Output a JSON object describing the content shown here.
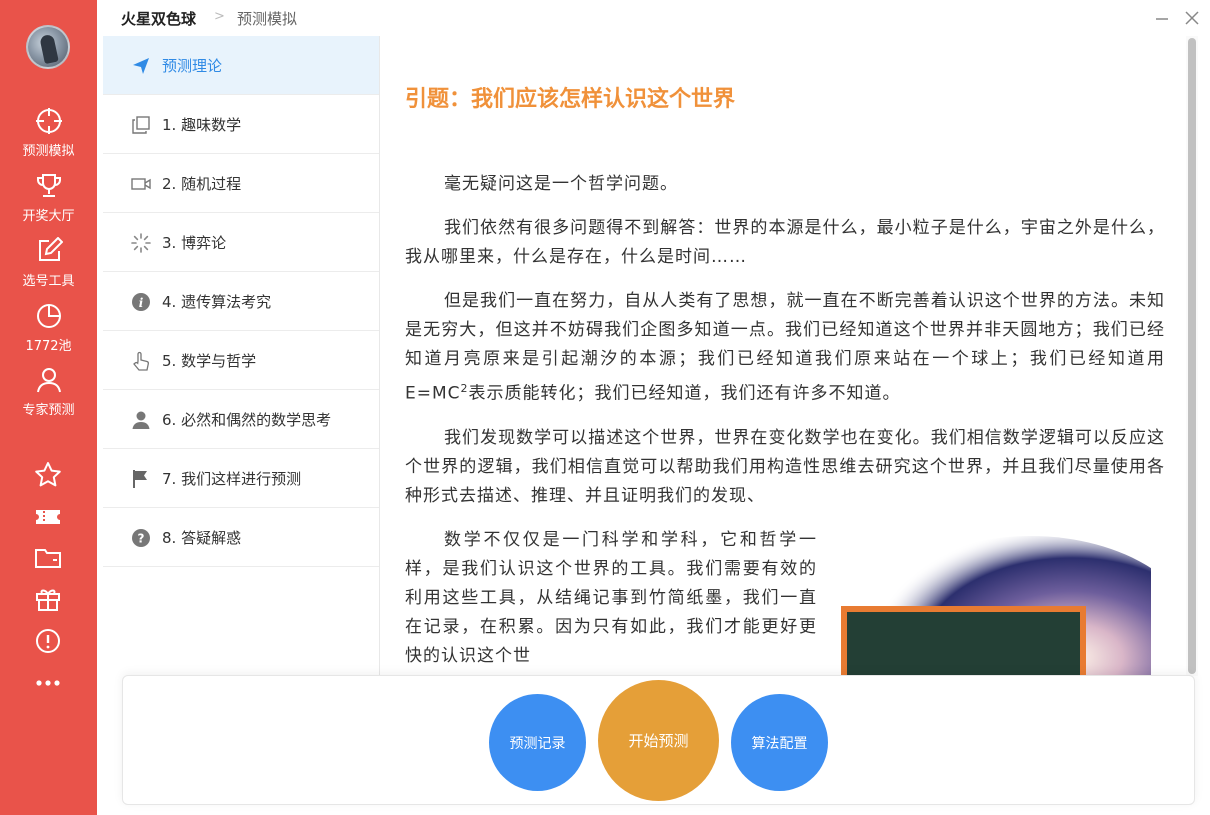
{
  "app": {
    "title": "火星双色球"
  },
  "breadcrumb": {
    "separator": ">",
    "current": "预测模拟"
  },
  "rail": {
    "nav": [
      {
        "label": "预测模拟",
        "icon": "crosshair-icon"
      },
      {
        "label": "开奖大厅",
        "icon": "trophy-icon"
      },
      {
        "label": "选号工具",
        "icon": "edit-icon"
      },
      {
        "label": "1772池",
        "icon": "pie-chart-icon"
      },
      {
        "label": "专家预测",
        "icon": "user-icon"
      }
    ],
    "extra_icons": [
      "star-icon",
      "ticket-icon",
      "folder-icon",
      "gift-icon",
      "alert-circle-icon",
      "more-icon"
    ]
  },
  "menu": {
    "items": [
      {
        "label": "预测理论",
        "icon": "send-icon",
        "active": true
      },
      {
        "label": "1. 趣味数学",
        "icon": "copy-icon"
      },
      {
        "label": "2. 随机过程",
        "icon": "video-icon"
      },
      {
        "label": "3. 博弈论",
        "icon": "loading-icon"
      },
      {
        "label": "4. 遗传算法考究",
        "icon": "info-icon"
      },
      {
        "label": "5. 数学与哲学",
        "icon": "pointer-hand-icon"
      },
      {
        "label": "6. 必然和偶然的数学思考",
        "icon": "person-icon"
      },
      {
        "label": "7. 我们这样进行预测",
        "icon": "flag-icon"
      },
      {
        "label": "8. 答疑解惑",
        "icon": "question-icon"
      }
    ]
  },
  "article": {
    "title": "引题：我们应该怎样认识这个世界",
    "p1": "毫无疑问这是一个哲学问题。",
    "p2": "我们依然有很多问题得不到解答：世界的本源是什么，最小粒子是什么，宇宙之外是什么，我从哪里来，什么是存在，什么是时间……",
    "p3a": "但是我们一直在努力，自从人类有了思想，就一直在不断完善着认识这个世界的方法。未知是无穷大，但这并不妨碍我们企图多知道一点。我们已经知道这个世界并非天圆地方；我们已经知道月亮原来是引起潮汐的本源；我们已经知道我们原来站在一个球上；我们已经知道用E=MC",
    "p3sup": "2",
    "p3b": "表示质能转化；我们已经知道，我们还有许多不知道。",
    "p4": "我们发现数学可以描述这个世界，世界在变化数学也在变化。我们相信数学逻辑可以反应这个世界的逻辑，我们相信直觉可以帮助我们用构造性思维去研究这个世界，并且我们尽量使用各种形式去描述、推理、并且证明我们的发现、",
    "p5": "数学不仅仅是一门科学和学科，它和哲学一样，是我们认识这个世界的工具。我们需要有效的利用这些工具，从结绳记事到竹简纸墨，我们一直在记录，在积累。因为只有如此，我们才能更好更快的认识这个世"
  },
  "actions": {
    "record": "预测记录",
    "start": "开始预测",
    "config": "算法配置"
  },
  "colors": {
    "rail": "#e9534a",
    "accent_blue": "#3d8ff2",
    "accent_orange": "#e59f38",
    "title_orange": "#f0913a"
  }
}
